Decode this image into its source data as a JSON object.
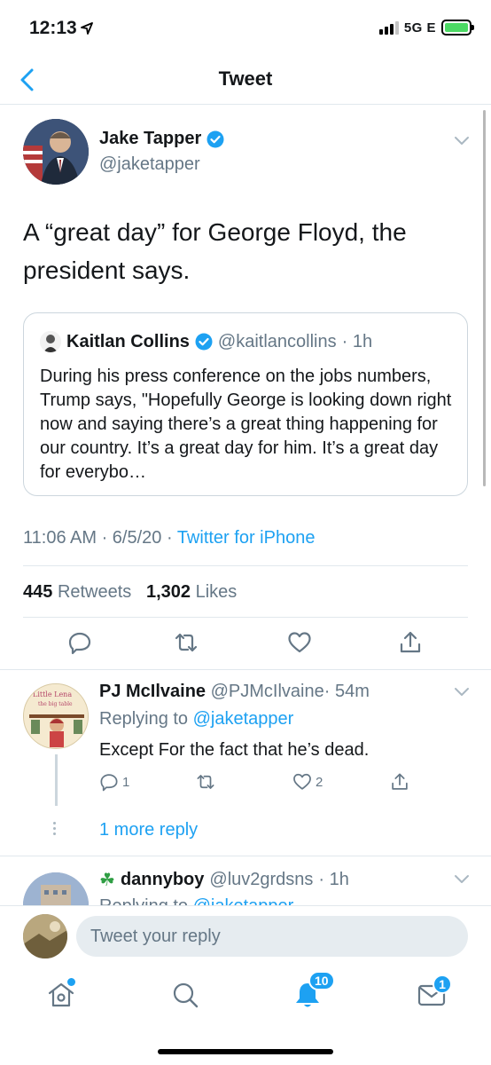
{
  "status_bar": {
    "time": "12:13",
    "network": "5G E"
  },
  "nav": {
    "title": "Tweet"
  },
  "tweet": {
    "author_name": "Jake Tapper",
    "author_handle": "@jaketapper",
    "text": "A “great day” for George Floyd, the president says.",
    "quote": {
      "name": "Kaitlan Collins",
      "handle": "@kaitlancollins",
      "age": "· 1h",
      "text": "During his press conference on the jobs numbers, Trump says, \"Hopefully George is looking down right now and saying there’s a great thing happening for our country. It’s a great day for him. It’s a great day for everybo…"
    },
    "time": "11:06 AM · 6/5/20 · ",
    "source": "Twitter for iPhone",
    "retweets_count": "445",
    "retweets_label": "Retweets",
    "likes_count": "1,302",
    "likes_label": "Likes"
  },
  "replies": [
    {
      "name": "PJ McIlvaine",
      "handle": "@PJMcIlvaine",
      "age": "· 54m",
      "replying_prefix": "Replying to ",
      "replying_to": "@jaketapper",
      "text": "Except For the fact that he’s dead.",
      "reply_count": "1",
      "like_count": "2",
      "more_replies": "1 more reply"
    },
    {
      "name": "dannyboy",
      "handle": "@luv2grdsns",
      "age": "· 1h",
      "replying_prefix": "Replying to ",
      "replying_to": "@jaketapper"
    }
  ],
  "composer": {
    "placeholder": "Tweet your reply"
  },
  "tabbar": {
    "notifications_badge": "10",
    "messages_badge": "1"
  },
  "colors": {
    "accent": "#1da1f2",
    "secondary_text": "#657786",
    "divider": "#e1e8ed"
  },
  "icons": [
    "location-arrow-icon",
    "signal-icon",
    "battery-icon",
    "back-chevron-icon",
    "verified-badge-icon",
    "chevron-down-icon",
    "reply-icon",
    "retweet-icon",
    "like-icon",
    "share-icon",
    "home-icon",
    "search-icon",
    "notifications-icon",
    "messages-icon"
  ]
}
